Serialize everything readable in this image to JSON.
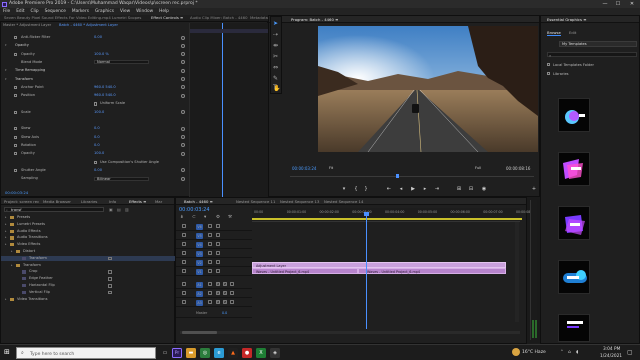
{
  "window": {
    "title": "Adobe Premiere Pro 2019 - C:\\Users\\Muhammad Waqar\\Videos\\p\\screen rec.prproj *",
    "minimize": "—",
    "maximize": "☐",
    "close": "✕"
  },
  "menu": [
    "File",
    "Edit",
    "Clip",
    "Sequence",
    "Markers",
    "Graphics",
    "View",
    "Window",
    "Help"
  ],
  "workspaces": [
    "Seven Beauty Pixel Sound Effects For Video Editing.mp4",
    "Lumetri Scopes",
    "Effect Controls ≡",
    "Audio Clip Mixer: Batch - 4460",
    "Metadata"
  ],
  "effect_controls": {
    "source_label": "Master * Adjustment Layer",
    "seq_label": "Batch - 4460 * Adjustment Layer",
    "rows": [
      {
        "label": "Anti-flicker Filter",
        "value": "0.00",
        "type": "value"
      },
      {
        "label": "Opacity",
        "value": "",
        "type": "section"
      },
      {
        "label": "Opacity",
        "value": "100.0 %",
        "type": "value"
      },
      {
        "label": "Blend Mode",
        "value": "Normal",
        "type": "dropdown"
      },
      {
        "label": "Time Remapping",
        "value": "",
        "type": "section"
      },
      {
        "label": "Transform",
        "value": "",
        "type": "section"
      },
      {
        "label": "Anchor Point",
        "value": "960.0   540.0",
        "type": "value"
      },
      {
        "label": "Position",
        "value": "960.0   540.0",
        "type": "value"
      },
      {
        "label": "",
        "value": "Uniform Scale",
        "type": "checkbox"
      },
      {
        "label": "Scale",
        "value": "100.0",
        "type": "value"
      },
      {
        "label": "",
        "value": "",
        "type": "blank"
      },
      {
        "label": "Skew",
        "value": "0.0",
        "type": "value"
      },
      {
        "label": "Skew Axis",
        "value": "0.0",
        "type": "value"
      },
      {
        "label": "Rotation",
        "value": "0.0",
        "type": "value"
      },
      {
        "label": "Opacity",
        "value": "100.0",
        "type": "value"
      },
      {
        "label": "",
        "value": "Use Composition's Shutter Angle",
        "type": "checkbox"
      },
      {
        "label": "Shutter Angle",
        "value": "0.00",
        "type": "value"
      },
      {
        "label": "Sampling",
        "value": "Bilinear",
        "type": "dropdown"
      }
    ],
    "timecode": "00:00:03:24"
  },
  "program": {
    "title": "Program: Batch - 4460 ≡",
    "timecode": "00:00:03:24",
    "fit": "Fit",
    "quality": "Full",
    "duration": "00:00:08:16"
  },
  "effects_panel": {
    "tabs": [
      "Project: screen rec",
      "Media Browser",
      "Libraries",
      "Info",
      "Effects ≡",
      "Mar"
    ],
    "search_value": "transf",
    "tree": [
      {
        "label": "Presets",
        "indent": 0,
        "kind": "folder"
      },
      {
        "label": "Lumetri Presets",
        "indent": 0,
        "kind": "folder"
      },
      {
        "label": "Audio Effects",
        "indent": 0,
        "kind": "folder"
      },
      {
        "label": "Audio Transitions",
        "indent": 0,
        "kind": "folder"
      },
      {
        "label": "Video Effects",
        "indent": 0,
        "kind": "folder"
      },
      {
        "label": "Distort",
        "indent": 1,
        "kind": "folder"
      },
      {
        "label": "Transform",
        "indent": 2,
        "kind": "fx",
        "selected": true
      },
      {
        "label": "Transform",
        "indent": 1,
        "kind": "folder"
      },
      {
        "label": "Crop",
        "indent": 2,
        "kind": "fx"
      },
      {
        "label": "Edge Feather",
        "indent": 2,
        "kind": "fx"
      },
      {
        "label": "Horizontal Flip",
        "indent": 2,
        "kind": "fx"
      },
      {
        "label": "Vertical Flip",
        "indent": 2,
        "kind": "fx"
      },
      {
        "label": "Video Transitions",
        "indent": 0,
        "kind": "folder"
      }
    ]
  },
  "timeline": {
    "tabs": [
      "Batch - 4460 ≡",
      "Nested Sequence 11",
      "Nested Sequence 13",
      "Nested Sequence 14"
    ],
    "timecode": "00:00:03:24",
    "ruler": [
      "00:00",
      "00:00:01:00",
      "00:00:02:00",
      "00:00:03:00",
      "00:00:04:00",
      "00:00:05:00",
      "00:00:06:00",
      "00:00:07:00",
      "00:00:08:00"
    ],
    "tracks": [
      {
        "name": "V6",
        "kind": "video"
      },
      {
        "name": "V5",
        "kind": "video"
      },
      {
        "name": "V4",
        "kind": "video"
      },
      {
        "name": "V3",
        "kind": "video"
      },
      {
        "name": "V2",
        "kind": "video"
      },
      {
        "name": "V1",
        "kind": "video"
      },
      {
        "name": "A1",
        "kind": "audio"
      },
      {
        "name": "A2",
        "kind": "audio"
      },
      {
        "name": "A3",
        "kind": "audio"
      }
    ],
    "master": "Master",
    "master_value": "0.0",
    "clips": {
      "adjustment": "Adjustment Layer",
      "clip1": "Waves - Untitled Project_6.mp4",
      "clip2": "Waves - Untitled Project_6.mp4"
    }
  },
  "essential_graphics": {
    "title": "Essential Graphics ≡",
    "tabs": [
      "Browse",
      "Edit"
    ],
    "dropdown": "My Templates",
    "checkboxes": [
      "Local Templates Folder",
      "Libraries"
    ]
  },
  "taskbar": {
    "search_placeholder": "Type here to search",
    "weather": "16°C  Haze",
    "time": "3:04 PM",
    "date": "1/24/2021"
  },
  "colors": {
    "accent": "#3d8bfd",
    "clip_purple": "#c9a0dc",
    "playhead": "#4a90ff",
    "timecode_blue": "#4a9bff"
  }
}
